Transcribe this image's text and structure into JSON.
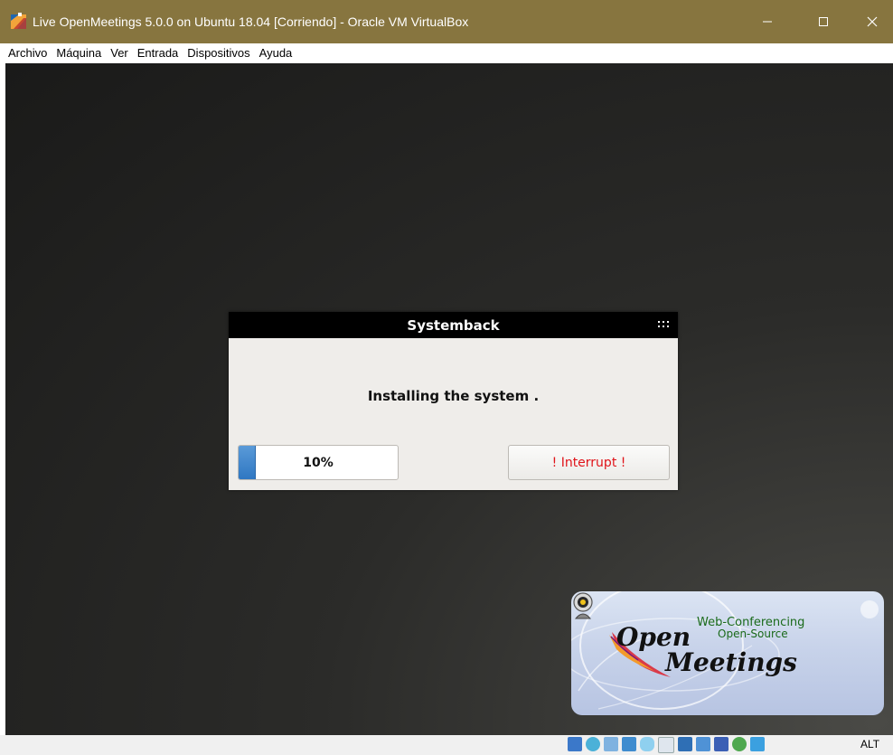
{
  "window": {
    "title": "Live OpenMeetings 5.0.0 on Ubuntu 18.04 [Corriendo] - Oracle VM VirtualBox",
    "accent": "#87753f"
  },
  "menubar": {
    "items": [
      "Archivo",
      "Máquina",
      "Ver",
      "Entrada",
      "Dispositivos",
      "Ayuda"
    ]
  },
  "dialog": {
    "title": "Systemback",
    "message": "Installing the system .",
    "progress_label": "10%",
    "progress_value": 0.1,
    "interrupt_label": "! Interrupt !"
  },
  "logo": {
    "word1": "Open",
    "word2": "Meetings",
    "tagline1": "Web-Conferencing",
    "tagline2": "Open-Source"
  },
  "statusbar": {
    "icons": [
      "hard-disk-icon",
      "optical-drive-icon",
      "audio-icon",
      "network-icon",
      "usb-icon",
      "shared-folders-icon",
      "display-icon",
      "screen-capture-icon",
      "video-capture-icon",
      "cpu-icon",
      "mouse-integration-icon"
    ],
    "host_key": "ALT"
  }
}
